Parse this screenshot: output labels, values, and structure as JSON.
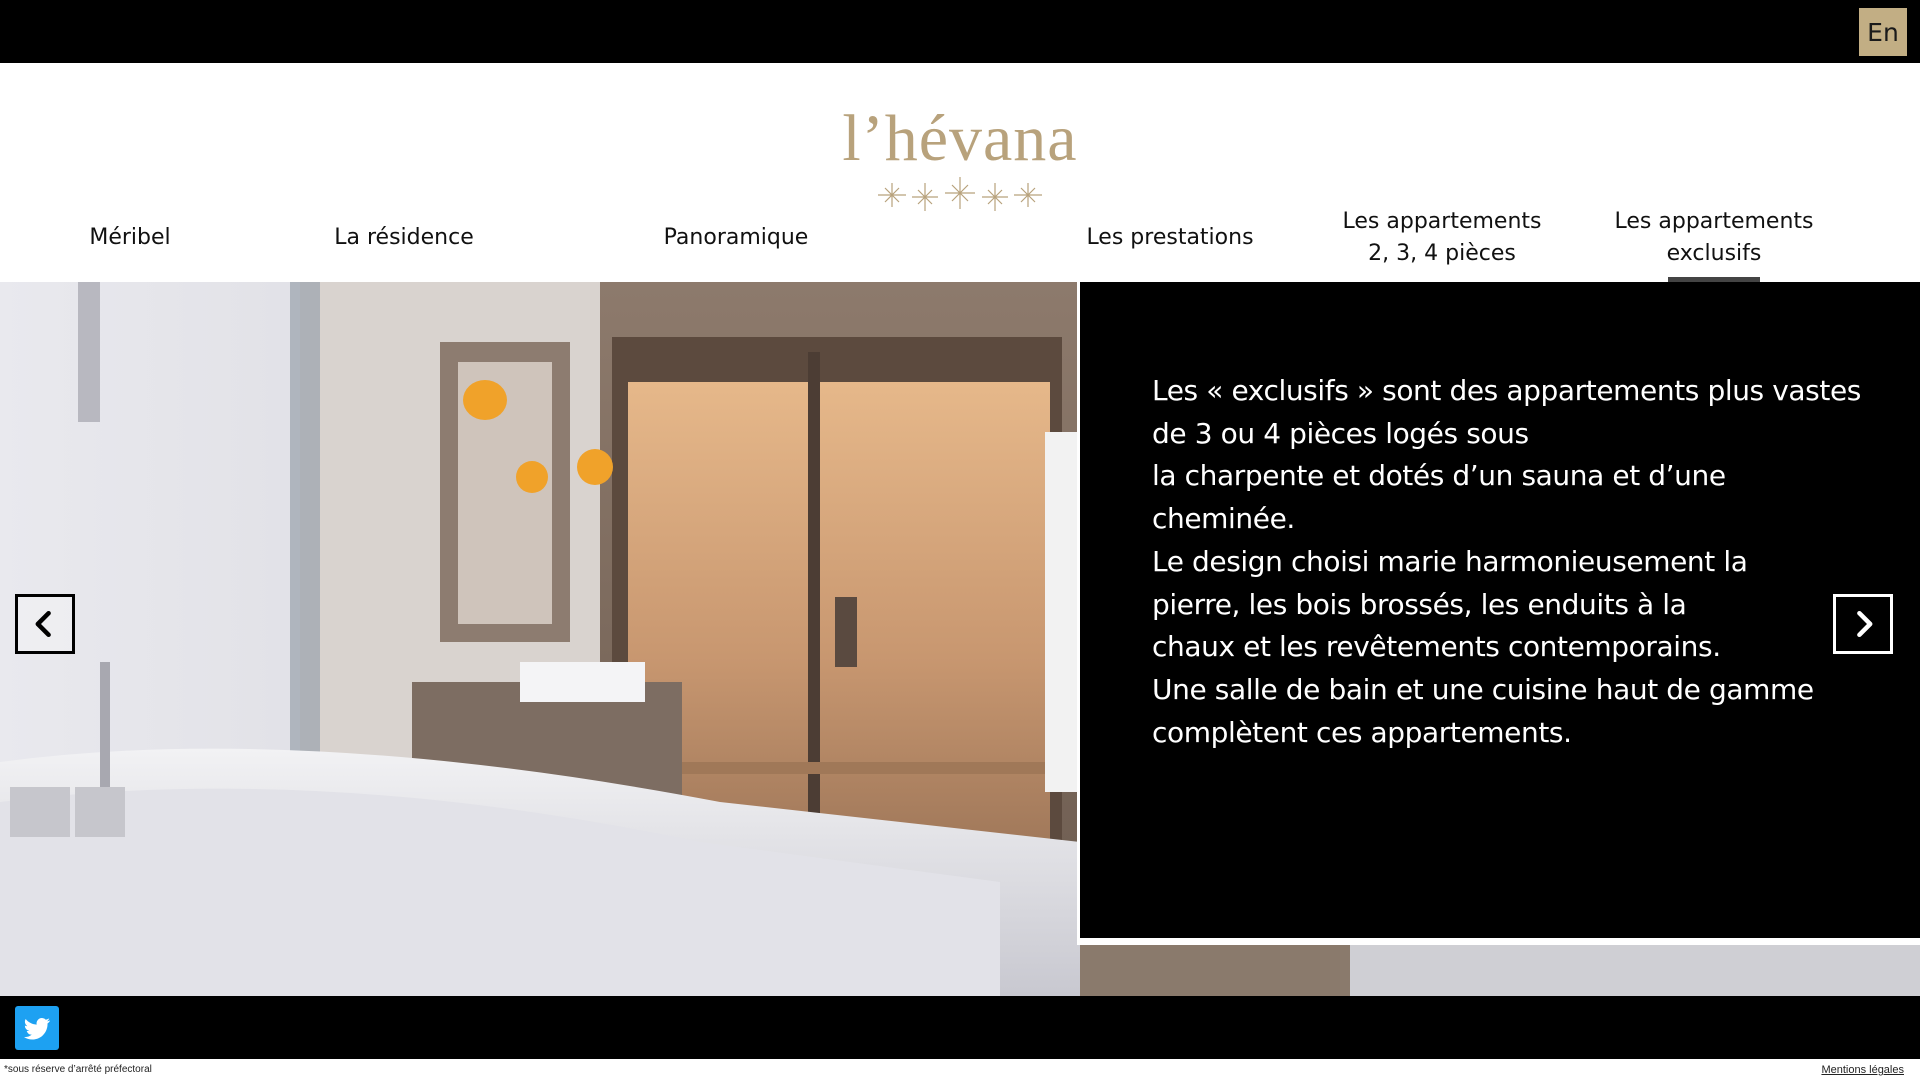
{
  "topbar": {
    "lang_label": "En"
  },
  "logo": {
    "text": "l’hévana",
    "stars_count": 5,
    "brand_color": "#b8a27c"
  },
  "nav": {
    "items": [
      {
        "line1": "Méribel",
        "line2": ""
      },
      {
        "line1": "La résidence",
        "line2": ""
      },
      {
        "line1": "Panoramique",
        "line2": ""
      },
      {
        "line1": "Les prestations",
        "line2": ""
      },
      {
        "line1": "Les appartements",
        "line2": "2, 3, 4 pièces"
      },
      {
        "line1": "Les appartements",
        "line2": "exclusifs"
      }
    ],
    "active_index": 5
  },
  "slider": {
    "image_icon": "bathroom-sauna-photo",
    "lines": [
      "Les « exclusifs » sont des appartements plus vastes",
      "de 3 ou 4 pièces logés sous",
      "la charpente et dotés d’un sauna et d’une",
      "cheminée.",
      "Le design choisi marie harmonieusement la",
      "pierre, les bois brossés, les enduits à la",
      "chaux et les revêtements contemporains.",
      "Une salle de bain et une cuisine haut de gamme",
      "complètent ces appartements."
    ],
    "prev_icon": "chevron-left-icon",
    "next_icon": "chevron-right-icon"
  },
  "footer": {
    "social_icon": "twitter-icon",
    "disclaimer": "*sous réserve d’arrêté préfectoral",
    "legal_link": "Mentions légales"
  },
  "colors": {
    "accent": "#c2ae84",
    "twitter": "#1da1f2"
  }
}
